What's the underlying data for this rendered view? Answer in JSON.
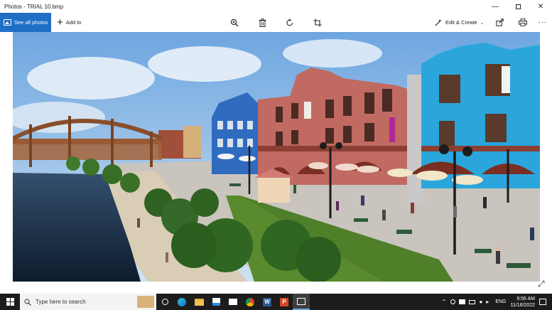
{
  "window": {
    "title": "Photos - TRIAL 10.bmp",
    "minimize_icon": "minimize-icon",
    "maximize_icon": "maximize-icon",
    "close_icon": "close-icon"
  },
  "toolbar": {
    "see_all_label": "See all photos",
    "add_to_label": "Add to",
    "edit_create_label": "Edit & Create",
    "accent": "#1f6fc7",
    "tools": [
      "zoom-icon",
      "delete-icon",
      "rotate-icon",
      "crop-icon",
      "share-icon",
      "print-icon",
      "more-icon"
    ]
  },
  "photo": {
    "description_icon": "rendered-plaza-image"
  },
  "taskbar": {
    "search_placeholder": "Type here to search",
    "apps": [
      "task-view-icon",
      "edge-icon",
      "file-explorer-icon",
      "store-icon",
      "mail-icon",
      "chrome-icon",
      "word-icon",
      "powerpoint-icon",
      "photos-icon"
    ],
    "language": "ENG",
    "time": "9:56 AM",
    "date": "11/16/2022"
  }
}
